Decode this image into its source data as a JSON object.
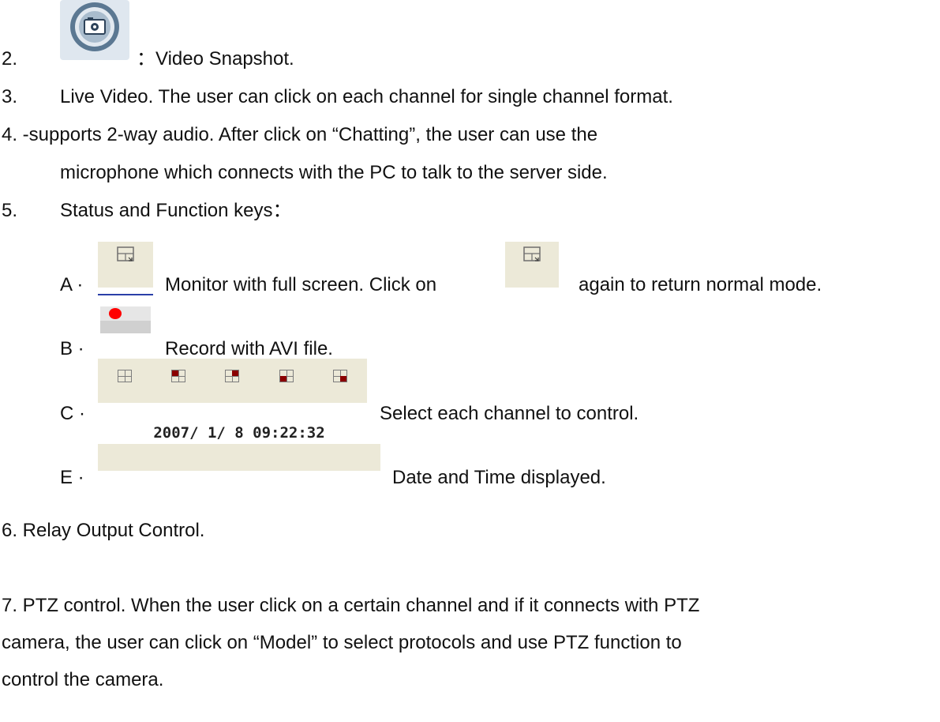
{
  "items": {
    "i2_num": "2.",
    "i2_text": "：Video Snapshot.",
    "i2_icon": "camera-snapshot-icon",
    "i3_num": "3.",
    "i3_text": "Live Video. The user can click on each channel for single channel format.",
    "i4_line1": "4. -supports 2-way audio. After click on “Chatting”, the user can use the",
    "i4_line2": "microphone which connects with the PC to talk to the server side.",
    "i5_num": "5.",
    "i5_text": "Status and Function keys：",
    "A_label": "A ·",
    "A_text1": "Monitor with full screen. Click on",
    "A_text2": "again to return normal mode.",
    "A_icon": "fullscreen-icon",
    "B_label": "B ·",
    "B_text": "Record with AVI file.",
    "B_icon": "record-icon",
    "C_label": "C ·",
    "C_text": "Select each channel to control.",
    "C_icon": "channel-select-icon",
    "E_label": "E ·",
    "E_datetime": "2007/ 1/ 8 09:22:32",
    "E_text": "Date and Time displayed.",
    "i6_text": "6. Relay Output Control.",
    "i7_line1": "7. PTZ control. When the user click on a certain channel and if it connects with PTZ",
    "i7_line2": "camera, the user can click on “Model” to select protocols and use PTZ function to",
    "i7_line3": "control the camera."
  },
  "colors": {
    "button_bg": "#ece9d8",
    "record_red": "#ff0000",
    "channel_red": "#8a0000"
  }
}
